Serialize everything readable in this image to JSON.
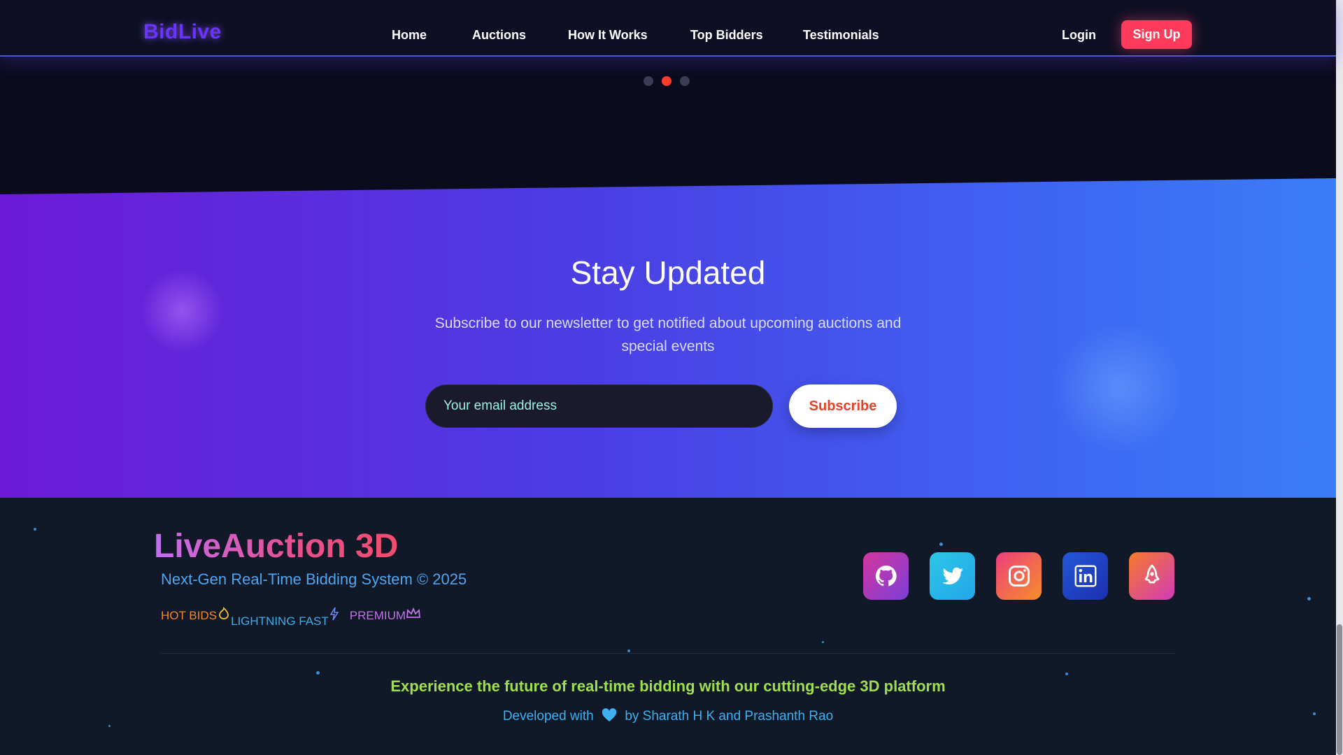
{
  "nav": {
    "logo": "BidLive",
    "links": [
      "Home",
      "Auctions",
      "How It Works",
      "Top Bidders",
      "Testimonials"
    ],
    "login": "Login",
    "signup": "Sign Up"
  },
  "carousel": {
    "slide_count": 3,
    "active_index": 1
  },
  "newsletter": {
    "title": "Stay Updated",
    "subtitle": "Subscribe to our newsletter to get notified about upcoming auctions and special events",
    "email_placeholder": "Your email address",
    "button": "Subscribe"
  },
  "footer": {
    "brand": "LiveAuction 3D",
    "tagline": "Next-Gen Real-Time Bidding System © 2025",
    "badges": {
      "hot": "HOT BIDS",
      "fast": "LIGHTNING FAST",
      "premium": "PREMIUM"
    },
    "socials": [
      "github-icon",
      "twitter-icon",
      "instagram-icon",
      "linkedin-icon",
      "rocket-icon"
    ],
    "experience": "Experience the future of real-time bidding with our cutting-edge 3D platform",
    "credits_prefix": "Developed with",
    "credits_suffix": "by Sharath H K and Prashanth Rao"
  },
  "colors": {
    "accent": "#ff3b5c",
    "nav_bg": "#0e0f24",
    "footer_bg": "#111827",
    "newsletter_start": "#6c1ad6",
    "newsletter_end": "#3a7df8"
  }
}
